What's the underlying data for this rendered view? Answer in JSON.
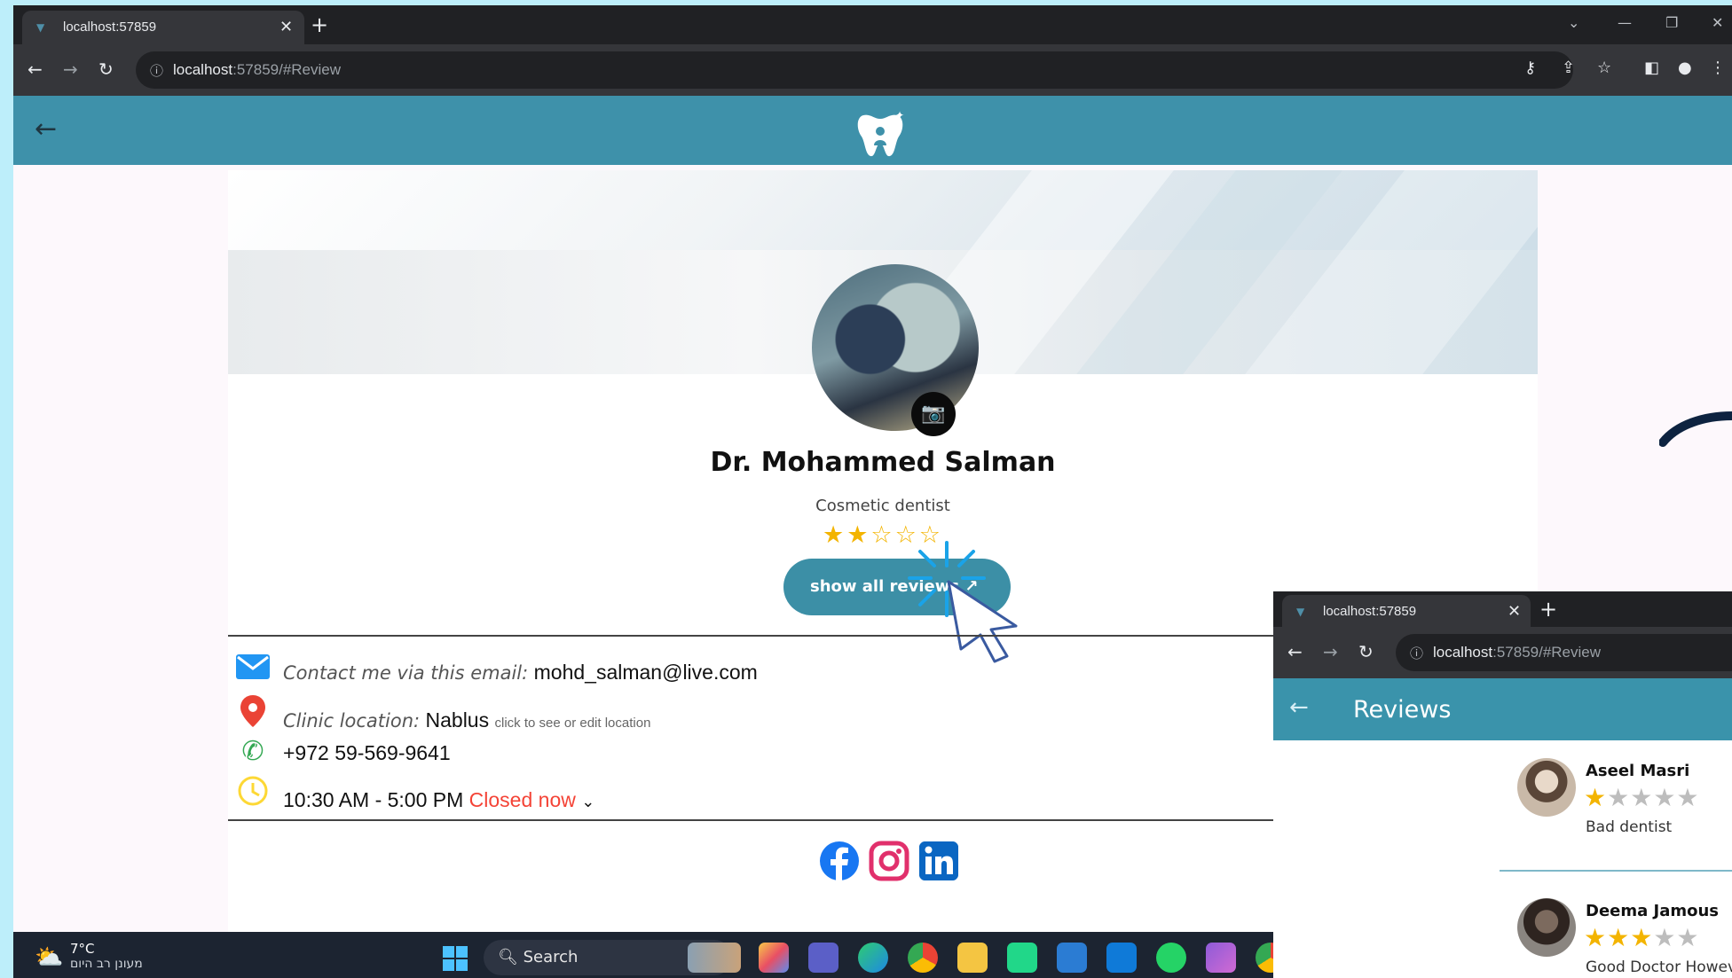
{
  "browser": {
    "tab_title": "localhost:57859",
    "url_host": "localhost",
    "url_rest": ":57859/#Review"
  },
  "profile": {
    "name": "Dr. Mohammed Salman",
    "specialty": "Cosmetic dentist",
    "rating": 2,
    "rating_max": 5,
    "show_reviews_label": "show all reviews"
  },
  "contact": {
    "email_label": "Contact me via this email:",
    "email": "mohd_salman@live.com",
    "location_label": "Clinic location:",
    "location": "Nablus",
    "location_hint": "click to see or edit location",
    "phone": "+972 59-569-9641",
    "hours": "10:30 AM - 5:00 PM",
    "status": "Closed now"
  },
  "taskbar": {
    "temp": "7°C",
    "weather_desc": "מעונן רב היום",
    "search_label": "Search"
  },
  "reviews_window": {
    "tab_title": "localhost:57859",
    "url_host": "localhost",
    "url_rest": ":57859/#Review",
    "title": "Reviews",
    "reviews": [
      {
        "name": "Aseel Masri",
        "rating": 1,
        "text": "Bad dentist"
      },
      {
        "name": "Deema Jamous",
        "rating": 3,
        "text": "Good Doctor Howev"
      }
    ]
  },
  "colors": {
    "app_header": "#3e91aa",
    "accent_button": "#3c8fa6",
    "star": "#f3b400",
    "closed": "#f44336"
  }
}
